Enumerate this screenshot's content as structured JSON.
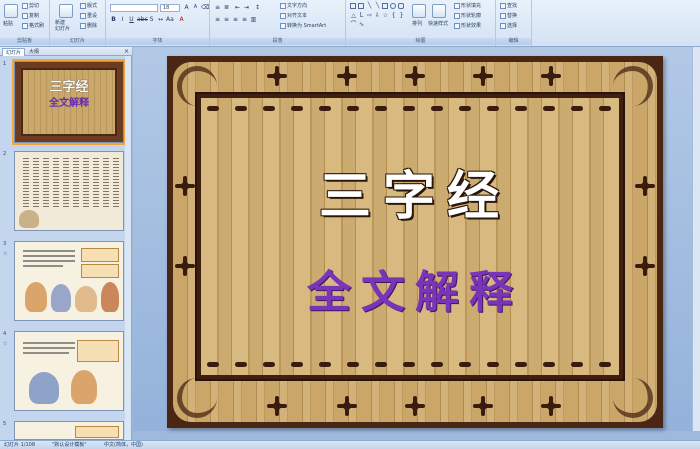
{
  "ribbon": {
    "clipboard": {
      "group_label": "剪贴板",
      "paste": "粘贴",
      "cut": "剪切",
      "copy": "复制",
      "format_painter": "格式刷"
    },
    "slides": {
      "group_label": "幻灯片",
      "new_slide": "新建\n幻灯片",
      "layout": "版式",
      "reset": "重设",
      "delete": "删除"
    },
    "font": {
      "group_label": "字体",
      "font_name": "",
      "font_size": "18"
    },
    "paragraph": {
      "group_label": "段落",
      "text_direction": "文字方向",
      "align_text": "对齐文本",
      "smartart": "转换为 SmartArt"
    },
    "drawing": {
      "group_label": "绘图",
      "arrange": "排列",
      "quick_styles": "快速样式",
      "shape_fill": "形状填充",
      "shape_outline": "形状轮廓",
      "shape_effects": "形状效果"
    },
    "editing": {
      "group_label": "编辑",
      "find": "查找",
      "replace": "替换",
      "select": "选择"
    }
  },
  "pane": {
    "tabs": [
      "幻灯片",
      "大纲"
    ],
    "close": "×",
    "thumbnails": [
      {
        "number": "1",
        "title": "三字经",
        "subtitle": "全文解释"
      },
      {
        "number": "2"
      },
      {
        "number": "3",
        "mark": "☆"
      },
      {
        "number": "4",
        "mark": "☆"
      },
      {
        "number": "5"
      }
    ]
  },
  "slide": {
    "title": "三字经",
    "subtitle": "全文解释",
    "colors": {
      "frame": "#4a2614",
      "wood": "#caa668",
      "title": "#ffffff",
      "subtitle": "#7a34b8"
    }
  },
  "status": {
    "slide_index": "幻灯片 1/108",
    "theme": "\"默认设计模板\"",
    "language": "中文(简体，中国)"
  }
}
